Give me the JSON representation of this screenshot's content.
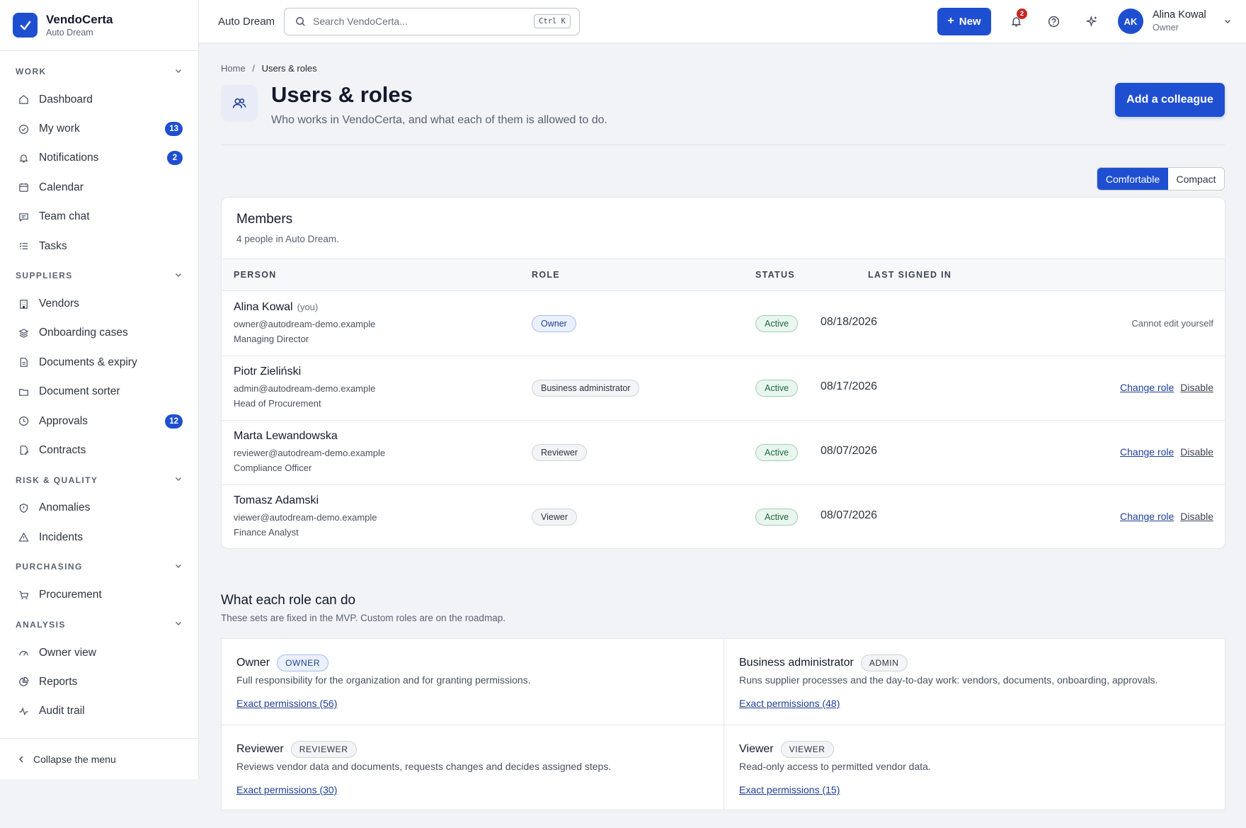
{
  "brand": {
    "name": "VendoCerta",
    "org": "Auto Dream"
  },
  "sidebar": {
    "sections": [
      {
        "title": "WORK",
        "items": [
          {
            "label": "Dashboard",
            "icon": "home-icon"
          },
          {
            "label": "My work",
            "icon": "check-circle-icon",
            "badge": "13"
          },
          {
            "label": "Notifications",
            "icon": "bell-icon",
            "badge": "2"
          },
          {
            "label": "Calendar",
            "icon": "calendar-icon"
          },
          {
            "label": "Team chat",
            "icon": "chat-icon"
          },
          {
            "label": "Tasks",
            "icon": "list-icon"
          }
        ]
      },
      {
        "title": "SUPPLIERS",
        "items": [
          {
            "label": "Vendors",
            "icon": "building-icon"
          },
          {
            "label": "Onboarding cases",
            "icon": "layers-icon"
          },
          {
            "label": "Documents & expiry",
            "icon": "document-icon"
          },
          {
            "label": "Document sorter",
            "icon": "folder-icon"
          },
          {
            "label": "Approvals",
            "icon": "clock-icon",
            "badge": "12"
          },
          {
            "label": "Contracts",
            "icon": "contract-icon"
          }
        ]
      },
      {
        "title": "RISK & QUALITY",
        "items": [
          {
            "label": "Anomalies",
            "icon": "shield-icon"
          },
          {
            "label": "Incidents",
            "icon": "warning-icon"
          }
        ]
      },
      {
        "title": "PURCHASING",
        "items": [
          {
            "label": "Procurement",
            "icon": "cart-icon"
          }
        ]
      },
      {
        "title": "ANALYSIS",
        "items": [
          {
            "label": "Owner view",
            "icon": "gauge-icon"
          },
          {
            "label": "Reports",
            "icon": "pie-icon"
          },
          {
            "label": "Audit trail",
            "icon": "activity-icon"
          }
        ]
      }
    ],
    "collapse_label": "Collapse the menu"
  },
  "topbar": {
    "org": "Auto Dream",
    "search_placeholder": "Search VendoCerta...",
    "search_shortcut": "Ctrl K",
    "new_label": "New",
    "notif_count": "2",
    "user": {
      "initials": "AK",
      "name": "Alina Kowal",
      "role": "Owner"
    }
  },
  "page": {
    "breadcrumb": {
      "home": "Home",
      "separator": "/",
      "current": "Users & roles"
    },
    "title": "Users & roles",
    "subtitle": "Who works in VendoCerta, and what each of them is allowed to do.",
    "add_button": "Add a colleague",
    "density": {
      "comfortable": "Comfortable",
      "compact": "Compact",
      "selected": "Comfortable"
    }
  },
  "members": {
    "title": "Members",
    "subtitle": "4 people in Auto Dream.",
    "columns": {
      "person": "PERSON",
      "role": "ROLE",
      "status": "STATUS",
      "last": "LAST SIGNED IN"
    },
    "rows": [
      {
        "name": "Alina Kowal",
        "you": "(you)",
        "email": "owner@autodream-demo.example",
        "title": "Managing Director",
        "role": "Owner",
        "status": "Active",
        "last": "08/18/2026",
        "note": "Cannot edit yourself"
      },
      {
        "name": "Piotr Zieliński",
        "email": "admin@autodream-demo.example",
        "title": "Head of Procurement",
        "role": "Business administrator",
        "status": "Active",
        "last": "08/17/2026",
        "change": "Change role",
        "disable": "Disable"
      },
      {
        "name": "Marta Lewandowska",
        "email": "reviewer@autodream-demo.example",
        "title": "Compliance Officer",
        "role": "Reviewer",
        "status": "Active",
        "last": "08/07/2026",
        "change": "Change role",
        "disable": "Disable"
      },
      {
        "name": "Tomasz Adamski",
        "email": "viewer@autodream-demo.example",
        "title": "Finance Analyst",
        "role": "Viewer",
        "status": "Active",
        "last": "08/07/2026",
        "change": "Change role",
        "disable": "Disable"
      }
    ]
  },
  "roles": {
    "title": "What each role can do",
    "subtitle": "These sets are fixed in the MVP. Custom roles are on the roadmap.",
    "items": [
      {
        "name": "Owner",
        "code": "OWNER",
        "desc": "Full responsibility for the organization and for granting permissions.",
        "link": "Exact permissions (56)"
      },
      {
        "name": "Business administrator",
        "code": "ADMIN",
        "desc": "Runs supplier processes and the day-to-day work: vendors, documents, onboarding, approvals.",
        "link": "Exact permissions (48)"
      },
      {
        "name": "Reviewer",
        "code": "REVIEWER",
        "desc": "Reviews vendor data and documents, requests changes and decides assigned steps.",
        "link": "Exact permissions (30)"
      },
      {
        "name": "Viewer",
        "code": "VIEWER",
        "desc": "Read-only access to permitted vendor data.",
        "link": "Exact permissions (15)"
      }
    ]
  },
  "colors": {
    "accent": "#1f4fd1",
    "success": "#1b6a3c",
    "danger": "#c62828"
  }
}
